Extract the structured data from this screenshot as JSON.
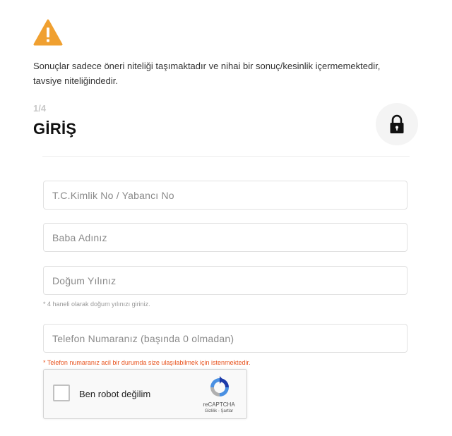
{
  "disclaimer": "Sonuçlar sadece öneri niteliği taşımaktadır ve nihai bir sonuç/kesinlik içermemektedir, tavsiye niteliğindedir.",
  "step": "1/4",
  "title": "GİRİŞ",
  "icons": {
    "warning": "warning-icon",
    "lock": "lock-icon",
    "recaptcha": "recaptcha-logo-icon"
  },
  "colors": {
    "warning": "#f0a030",
    "hint_red": "#e8531e",
    "step_gray": "#c8c8c8"
  },
  "form": {
    "tc_placeholder": "T.C.Kimlik No / Yabancı No",
    "father_placeholder": "Baba Adınız",
    "birth_year_placeholder": "Doğum Yılınız",
    "birth_year_hint": "* 4 haneli olarak doğum yılınızı giriniz.",
    "phone_placeholder": "Telefon Numaranız (başında 0 olmadan)",
    "phone_hint": "* Telefon numaranız acil bir durumda size ulaşılabilmek için istenmektedir."
  },
  "recaptcha": {
    "label": "Ben robot değilim",
    "brand": "reCAPTCHA",
    "links": "Gizlilik - Şartlar"
  }
}
